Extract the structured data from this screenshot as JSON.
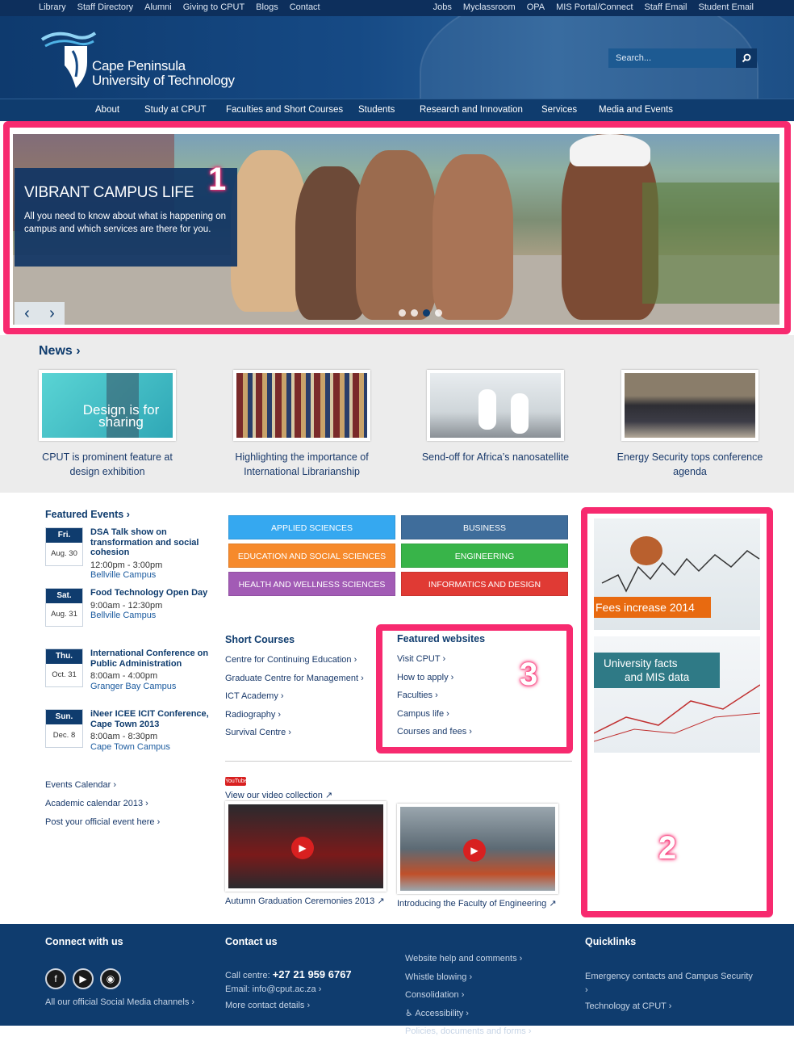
{
  "topbar": {
    "left": [
      "Library",
      "Staff Directory",
      "Alumni",
      "Giving to CPUT",
      "Blogs",
      "Contact"
    ],
    "right": [
      "Jobs",
      "Myclassroom",
      "OPA",
      "MIS Portal/Connect",
      "Staff Email",
      "Student Email"
    ]
  },
  "logo": {
    "line1": "Cape Peninsula",
    "line2": "University of Technology"
  },
  "search": {
    "placeholder": "Search..."
  },
  "nav": [
    "About",
    "Study at CPUT",
    "Faculties and Short Courses",
    "Students",
    "Research and Innovation",
    "Services",
    "Media and Events"
  ],
  "hero": {
    "title": "VIBRANT CAMPUS LIFE",
    "text": "All you need to know about what is happening on campus and which services are there for you.",
    "prev": "‹",
    "next": "›",
    "slides": 4,
    "active_slide": 3
  },
  "annotations": {
    "a1": "1",
    "a2": "2",
    "a3": "3"
  },
  "news": {
    "title": "News ›",
    "items": [
      {
        "caption": "CPUT is prominent feature at design exhibition",
        "img_text": "Design is for sharing"
      },
      {
        "caption": "Highlighting the importance of International Librarianship"
      },
      {
        "caption": "Send-off for Africa’s nanosatellite"
      },
      {
        "caption": "Energy Security tops conference agenda"
      }
    ]
  },
  "events": {
    "title": "Featured Events ›",
    "items": [
      {
        "day": "Fri.",
        "date": "Aug. 30",
        "name": "DSA Talk show on transformation and social cohesion",
        "time": "12:00pm - 3:00pm",
        "place": "Bellville Campus"
      },
      {
        "day": "Sat.",
        "date": "Aug. 31",
        "name": "Food Technology Open Day",
        "time": "9:00am - 12:30pm",
        "place": "Bellville Campus"
      },
      {
        "day": "Thu.",
        "date": "Oct. 31",
        "name": "International Conference on Public Administration",
        "time": "8:00am - 4:00pm",
        "place": "Granger Bay Campus"
      },
      {
        "day": "Sun.",
        "date": "Dec. 8",
        "name": "iNeer ICEE ICIT Conference, Cape Town 2013",
        "time": "8:00am - 8:30pm",
        "place": "Cape Town Campus"
      }
    ],
    "links": [
      "Events Calendar ›",
      "Academic calendar 2013 ›",
      "Post your official event here ›"
    ]
  },
  "faculties": [
    {
      "label": "APPLIED SCIENCES",
      "color": "#35a8f0"
    },
    {
      "label": "BUSINESS",
      "color": "#3f6d9b"
    },
    {
      "label": "EDUCATION AND SOCIAL SCIENCES",
      "color": "#f68a2c"
    },
    {
      "label": "ENGINEERING",
      "color": "#38b449"
    },
    {
      "label": "HEALTH AND WELLNESS SCIENCES",
      "color": "#a25bb5"
    },
    {
      "label": "INFORMATICS AND DESIGN",
      "color": "#e03a34"
    }
  ],
  "short_courses": {
    "title": "Short Courses",
    "links": [
      "Centre for Continuing Education ›",
      "Graduate Centre for Management ›",
      "ICT Academy ›",
      "Radiography ›",
      "Survival Centre ›"
    ]
  },
  "featured_websites": {
    "title": "Featured websites",
    "links": [
      "Visit CPUT ›",
      "How to apply ›",
      "Faculties ›",
      "Campus life ›",
      "Courses and fees ›"
    ]
  },
  "videos": {
    "logo": "YouTube",
    "collection": "View our video collection ↗",
    "items": [
      {
        "caption": "Autumn Graduation Ceremonies 2013 ↗"
      },
      {
        "caption": "Introducing the Faculty of Engineering ↗"
      }
    ]
  },
  "side": {
    "promo1": "Fees increase 2014",
    "promo2_l1": "University facts",
    "promo2_l2": "and MIS data"
  },
  "footer": {
    "connect": {
      "title": "Connect with us",
      "link": "All our official Social Media channels ›"
    },
    "contact": {
      "title": "Contact us",
      "call_label": "Call centre:",
      "call": "+27 21 959 6767",
      "email_label": "Email:",
      "email": "info@cput.ac.za ›",
      "more": "More contact details ›"
    },
    "help": [
      "Website help and comments ›",
      "Whistle blowing ›",
      "Consolidation ›",
      "Accessibility ›",
      "Policies, documents and forms ›"
    ],
    "quick": {
      "title": "Quicklinks",
      "links": [
        "Emergency contacts and Campus Security ›",
        "Technology at CPUT ›"
      ]
    }
  }
}
